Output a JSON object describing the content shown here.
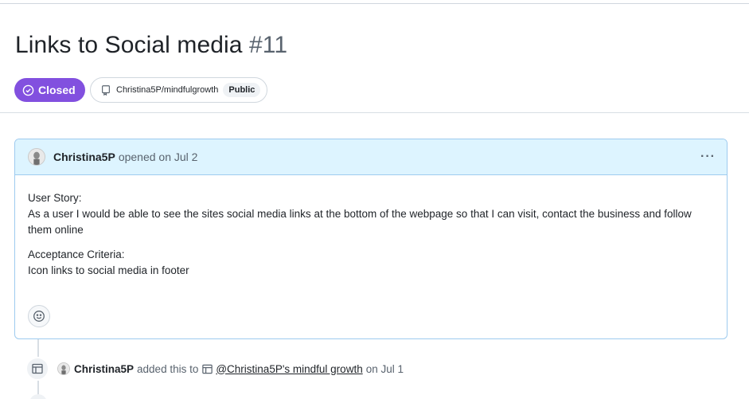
{
  "issue": {
    "title": "Links to Social media",
    "number": "#11",
    "state": "Closed",
    "repo": "Christina5P/mindfulgrowth",
    "visibility": "Public"
  },
  "comment": {
    "author": "Christina5P",
    "meta": "opened on Jul 2",
    "more_label": "···",
    "body": {
      "story_heading": "User Story:",
      "story_text": "As a user I would be able to see the sites social media links at the bottom of the webpage so that I can visit, contact the business and follow them online",
      "criteria_heading": "Acceptance Criteria:",
      "criteria_text": "Icon links to social media in footer"
    }
  },
  "timeline_event": {
    "actor": "Christina5P",
    "action": "added this to",
    "project": "@Christina5P's mindful growth",
    "when": "on Jul 1"
  },
  "icons": {
    "state": "issue-closed-icon",
    "repo": "repo-icon",
    "more": "kebab-horizontal-icon",
    "reaction": "smiley-icon",
    "project": "table-icon"
  },
  "colors": {
    "closed_badge": "#8250df",
    "comment_header_bg": "#ddf4ff",
    "comment_border": "#9ecbef"
  }
}
